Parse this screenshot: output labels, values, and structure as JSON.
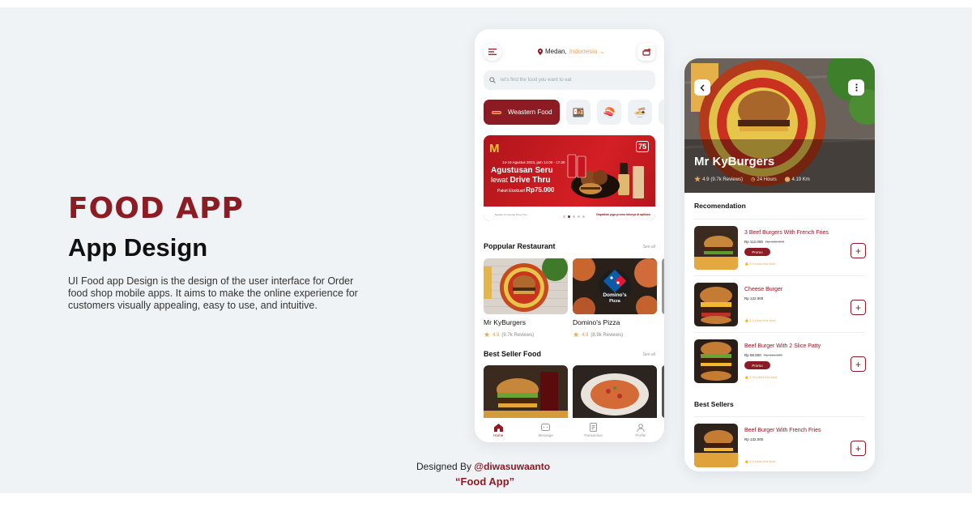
{
  "brand": "FOOD APP",
  "subtitle": "App Design",
  "description": "UI Food app Design is the design of the user interface for Order food shop mobile apps. It aims to make the online experience for customers visually appealing, easy to use, and intuitive.",
  "credit": {
    "prefix": "Designed By ",
    "handle": "@diwasuwaanto",
    "project": "“Food App”"
  },
  "colors": {
    "accent": "#8d1b23",
    "star": "#e9a85b",
    "background": "#eff3f6"
  },
  "home": {
    "location_city": "Medan,",
    "location_country": "Indonesia",
    "search_placeholder": "let's find the food you want to eat",
    "active_category": "Weastern Food",
    "categories_icons": [
      "bento-icon",
      "sushi-icon",
      "ramen-icon",
      "dumpling-icon"
    ],
    "banner": {
      "logo": "M",
      "date": "14-19 Agustus 2023, jam 14.00 - 17.00",
      "line1": "Agustusan Seru",
      "line2a": "lewat ",
      "line2b": "Drive Thru",
      "line3a": "Paket Eksklusif ",
      "line3b": "Rp75.000",
      "badge": "75",
      "footer": "Dapatkan juga promo lainnya di aplikasi",
      "footer_left": "Berlaku di restoran Drive Thru"
    },
    "popular_title": "Poppular Restaurant",
    "popular_see_all": "See all",
    "restaurants": [
      {
        "name": "Mr KyBurgers",
        "rating": "4.9",
        "reviews": "(9.7k Reviews)"
      },
      {
        "name": "Domino's Pizza",
        "rating": "4.9",
        "reviews": "(8.9k Reviews)"
      }
    ],
    "bestseller_title": "Best Seller Food",
    "bestseller_see_all": "See all",
    "nav": [
      "Home",
      "Message",
      "Transaction",
      "Profile"
    ]
  },
  "detail": {
    "title": "Mr KyBurgers",
    "rating": "4.9",
    "reviews": "(9.7k Reviews)",
    "hours": "24 Hours",
    "distance": "4.19 Km",
    "recommendation_title": "Recomendation",
    "items": [
      {
        "name": "3  Beef Burgers With French Fries",
        "price": "Rp 112.000",
        "old": "Rp 185.000",
        "promo": "Promo",
        "likes": "9.9 Likes this food"
      },
      {
        "name": "Cheese Burger",
        "price": "Rp 122.000",
        "old": "",
        "promo": "",
        "likes": "9.9 Likes this food"
      },
      {
        "name": "Beef Burger With 2 Slice Patty",
        "price": "Rp 96.500",
        "old": "Rp 115.000",
        "promo": "Promo",
        "likes": "9.7k Likes this food"
      }
    ],
    "bestsellers_title": "Best Sellers",
    "bestseller_item": {
      "name": "Beef Burger With French Fries",
      "price": "Rp 132.000",
      "likes": "9.9 Likes this food"
    }
  }
}
